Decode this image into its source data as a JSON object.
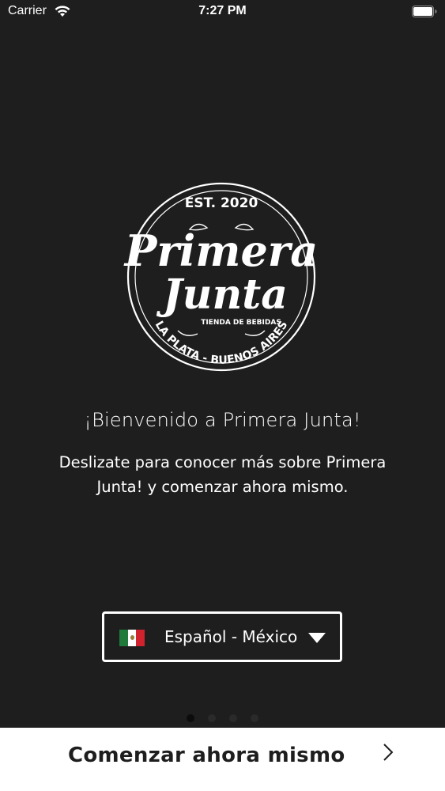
{
  "status_bar": {
    "carrier": "Carrier",
    "time": "7:27 PM"
  },
  "logo": {
    "est": "EST. 2020",
    "line1": "Primera",
    "line2": "Junta",
    "ribbon": "TIENDA DE BEBIDAS",
    "bottom": "LA PLATA - BUENOS AIRES"
  },
  "welcome": {
    "title": "¡Bienvenido a Primera Junta!",
    "subtitle": "Deslizate para conocer más sobre Primera Junta! y comenzar ahora mismo."
  },
  "language": {
    "selected": "Español - México",
    "flag_icon": "mexico-flag-icon"
  },
  "pager": {
    "total": 4,
    "active": 1
  },
  "start_button": {
    "label": "Comenzar ahora mismo"
  },
  "colors": {
    "background": "#1e1e1e",
    "text": "#ffffff",
    "bar": "#ffffff"
  }
}
